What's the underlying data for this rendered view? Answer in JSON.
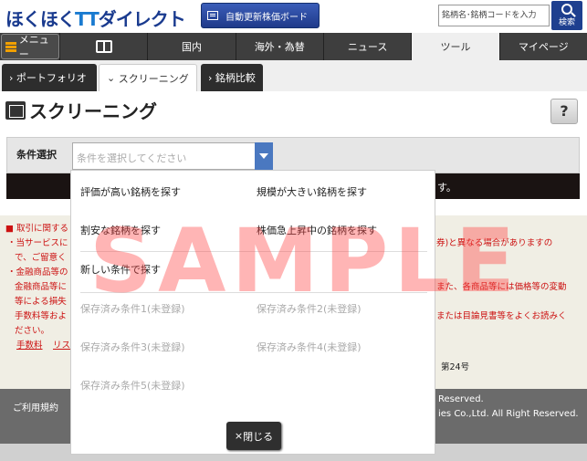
{
  "header": {
    "logo_part1": "ほくほく",
    "logo_part2": "TT",
    "logo_part3": "ダイレクト",
    "auto_update_label": "自動更新株価ボード",
    "search_placeholder": "銘柄名･銘柄コードを入力",
    "search_button": "検索"
  },
  "nav": {
    "menu_label": "メニュー",
    "tabs": [
      "国内",
      "海外・為替",
      "ニュース",
      "ツール",
      "マイページ"
    ],
    "active_tab": "ツール"
  },
  "subnav": {
    "items": [
      "ポートフォリオ",
      "スクリーニング",
      "銘柄比較"
    ],
    "active": "スクリーニング"
  },
  "page": {
    "title": "スクリーニング",
    "help_label": "?",
    "condition_label": "条件選択",
    "condition_placeholder": "条件を選択してください",
    "dark_bar_text": "す。"
  },
  "dropdown": {
    "options_col1": [
      "評価が高い銘柄を探す",
      "割安な銘柄を探す",
      "新しい条件で探す"
    ],
    "options_col2": [
      "規模が大きい銘柄を探す",
      "株価急上昇中の銘柄を探す"
    ],
    "saved_col1": [
      "保存済み条件1(未登録)",
      "保存済み条件3(未登録)",
      "保存済み条件5(未登録)"
    ],
    "saved_col2": [
      "保存済み条件2(未登録)",
      "保存済み条件4(未登録)"
    ],
    "close_label": "閉じる",
    "close_icon": "×"
  },
  "notice": {
    "left_lines": [
      "■ 取引に関する",
      "・当サービスに",
      "で、ご留意く",
      "・金融商品等の",
      "金融商品等に",
      "等による損失",
      "手数料等およ",
      "ださい。"
    ],
    "right_lines": [
      "券)と異なる場合がありますの",
      "また、各商品等には価格等の変動",
      "または目論見書等をよくお読みく"
    ],
    "links": [
      "手数料",
      "リス"
    ],
    "reg_number": "第24号"
  },
  "footer": {
    "terms_link": "ご利用規約",
    "copyright1": "Reserved.",
    "copyright2": "ies Co.,Ltd. All Right Reserved."
  },
  "watermark": "SAMPLE"
}
